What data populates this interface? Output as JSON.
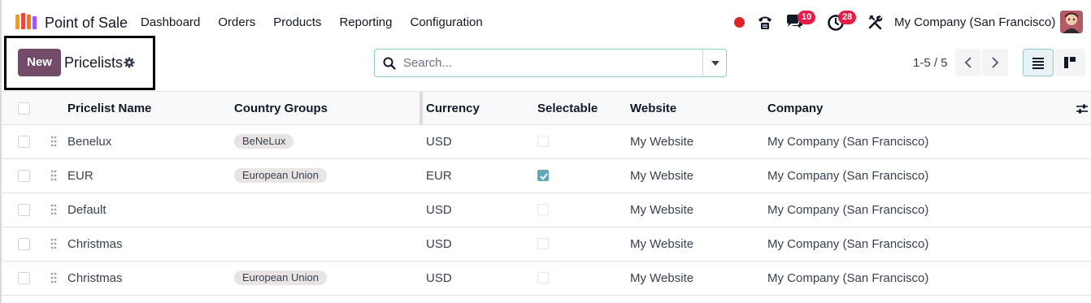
{
  "app": {
    "name": "Point of Sale",
    "menu": [
      "Dashboard",
      "Orders",
      "Products",
      "Reporting",
      "Configuration"
    ]
  },
  "systray": {
    "messages_count": "10",
    "activities_count": "28",
    "company": "My Company (San Francisco)"
  },
  "control_panel": {
    "new_label": "New",
    "breadcrumb": "Pricelists",
    "search_placeholder": "Search...",
    "pager": "1-5 / 5"
  },
  "table": {
    "headers": {
      "name": "Pricelist Name",
      "country_groups": "Country Groups",
      "currency": "Currency",
      "selectable": "Selectable",
      "website": "Website",
      "company": "Company"
    },
    "rows": [
      {
        "name": "Benelux",
        "country_group": "BeNeLux",
        "currency": "USD",
        "selectable": false,
        "website": "My Website",
        "company": "My Company (San Francisco)"
      },
      {
        "name": "EUR",
        "country_group": "European Union",
        "currency": "EUR",
        "selectable": true,
        "website": "My Website",
        "company": "My Company (San Francisco)"
      },
      {
        "name": "Default",
        "country_group": "",
        "currency": "USD",
        "selectable": false,
        "website": "My Website",
        "company": "My Company (San Francisco)"
      },
      {
        "name": "Christmas",
        "country_group": "",
        "currency": "USD",
        "selectable": false,
        "website": "My Website",
        "company": "My Company (San Francisco)"
      },
      {
        "name": "Christmas",
        "country_group": "European Union",
        "currency": "USD",
        "selectable": false,
        "website": "My Website",
        "company": "My Company (San Francisco)"
      }
    ]
  },
  "colors": {
    "brand": "#714b67",
    "accent": "#5faab4",
    "badge": "#e11d48"
  },
  "icons": [
    "app-logo-icon",
    "phone-icon",
    "chat-icon",
    "activity-clock-icon",
    "tools-icon",
    "gear-icon",
    "search-icon",
    "chevron-left-icon",
    "chevron-right-icon",
    "list-view-icon",
    "kanban-view-icon",
    "optional-columns-icon",
    "drag-handle-icon"
  ]
}
